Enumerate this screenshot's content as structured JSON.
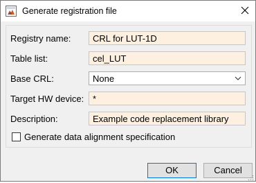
{
  "window": {
    "title": "Generate registration file",
    "icon": "matlab-app-icon",
    "close_icon": "close-icon"
  },
  "form": {
    "registry_name": {
      "label": "Registry name:",
      "value": "CRL for LUT-1D"
    },
    "table_list": {
      "label": "Table list:",
      "value": "cel_LUT"
    },
    "base_crl": {
      "label": "Base CRL:",
      "selected": "None"
    },
    "target_hw": {
      "label": "Target HW device:",
      "value": "*"
    },
    "description": {
      "label": "Description:",
      "value": "Example code replacement library"
    }
  },
  "checkbox": {
    "label": "Generate data alignment specification",
    "checked": false
  },
  "buttons": {
    "ok": "OK",
    "cancel": "Cancel"
  },
  "colors": {
    "field_bg": "#fdf0e0",
    "dialog_bg": "#f0f0f0",
    "default_button_border": "#0078d7"
  }
}
